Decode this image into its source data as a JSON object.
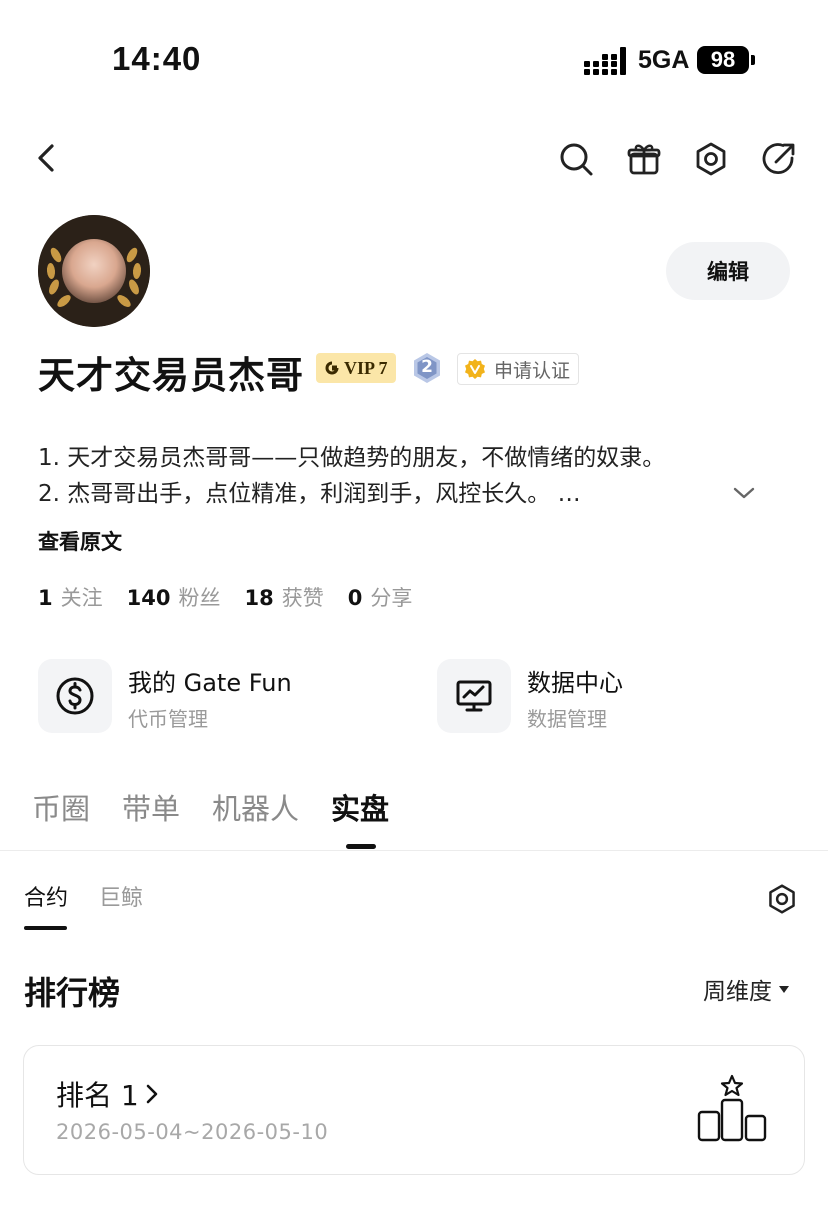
{
  "status_bar": {
    "time": "14:40",
    "network": "5GA",
    "battery": "98"
  },
  "profile": {
    "username": "天才交易员杰哥",
    "vip_label": "VIP 7",
    "level_badge": "2",
    "verify_label": "申请认证",
    "edit_label": "编辑",
    "bio_line1": "1. 天才交易员杰哥哥——只做趋势的朋友，不做情绪的奴隶。",
    "bio_line2": "2. 杰哥哥出手，点位精准，利润到手，风控长久。 …",
    "view_original": "查看原文"
  },
  "stats": [
    {
      "value": "1",
      "label": "关注"
    },
    {
      "value": "140",
      "label": "粉丝"
    },
    {
      "value": "18",
      "label": "获赞"
    },
    {
      "value": "0",
      "label": "分享"
    }
  ],
  "tools": [
    {
      "title": "我的 Gate Fun",
      "subtitle": "代币管理",
      "icon": "dollar-icon"
    },
    {
      "title": "数据中心",
      "subtitle": "数据管理",
      "icon": "chart-monitor-icon"
    }
  ],
  "tabs": [
    "币圈",
    "带单",
    "机器人",
    "实盘"
  ],
  "active_tab": "实盘",
  "subtabs": [
    "合约",
    "巨鲸"
  ],
  "leaderboard": {
    "title": "排行榜",
    "period": "周维度",
    "rank_label": "排名 1",
    "date_range": "2026-05-04~2026-05-10"
  }
}
